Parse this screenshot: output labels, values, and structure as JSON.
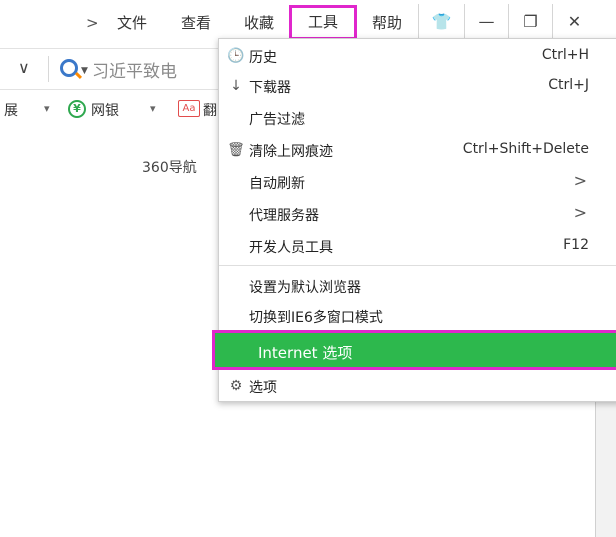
{
  "menubar": {
    "chevron": ">",
    "items": [
      "文件",
      "查看",
      "收藏",
      "工具",
      "帮助"
    ],
    "window_buttons": [
      "shirt-icon",
      "minimize-icon",
      "restore-icon",
      "close-icon"
    ],
    "window_glyphs": [
      "👕",
      "—",
      "❐",
      "✕"
    ]
  },
  "address": {
    "dropdown_glyph": "∨",
    "query": "习近平致电"
  },
  "bookmarks": {
    "left_text": "展",
    "arrow1": "▾",
    "bank": "网银",
    "arrow2": "▾",
    "aa": "Aa",
    "trail": "翻"
  },
  "page": {
    "nav_text": "360导航"
  },
  "menu": {
    "items": [
      {
        "icon": "clock-icon",
        "glyph": "🕒",
        "label": "历史",
        "shortcut": "Ctrl+H"
      },
      {
        "icon": "download-icon",
        "glyph": "↓",
        "label": "下载器",
        "shortcut": "Ctrl+J"
      },
      {
        "icon": "",
        "glyph": "",
        "label": "广告过滤",
        "shortcut": ""
      },
      {
        "icon": "trash-icon",
        "glyph": "🗑",
        "label": "清除上网痕迹",
        "shortcut": "Ctrl+Shift+Delete"
      },
      {
        "icon": "",
        "glyph": "",
        "label": "自动刷新",
        "shortcut": "",
        "arrow": ">"
      },
      {
        "icon": "",
        "glyph": "",
        "label": "代理服务器",
        "shortcut": "",
        "arrow": ">"
      },
      {
        "icon": "",
        "glyph": "",
        "label": "开发人员工具",
        "shortcut": "F12"
      },
      {
        "icon": "",
        "glyph": "",
        "label": "设置为默认浏览器",
        "shortcut": ""
      },
      {
        "icon": "",
        "glyph": "",
        "label": "切换到IE6多窗口模式",
        "shortcut": ""
      },
      {
        "icon": "",
        "glyph": "",
        "label": "Internet 选项",
        "shortcut": ""
      },
      {
        "icon": "gear-icon",
        "glyph": "⚙",
        "label": "选项",
        "shortcut": ""
      }
    ],
    "highlight_color": "#2db84d",
    "annotation_color": "#e026cc"
  }
}
